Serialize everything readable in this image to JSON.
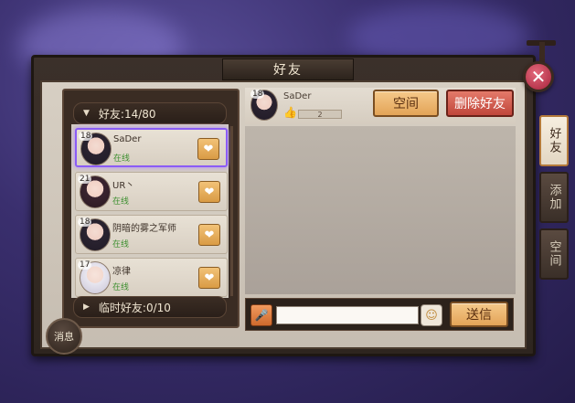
{
  "window": {
    "title": "好友",
    "close_label": "✕"
  },
  "friend_group": {
    "label": "好友:14/80"
  },
  "temp_group": {
    "label": "临时好友:0/10"
  },
  "friends": [
    {
      "level": "18",
      "name": "SaDer",
      "status": "在线",
      "selected": true
    },
    {
      "level": "21",
      "name": "UR丶",
      "status": "在线",
      "selected": false
    },
    {
      "level": "18",
      "name": "阴暗的雾之军师",
      "status": "在线",
      "selected": false
    },
    {
      "level": "17",
      "name": "凉律",
      "status": "在线",
      "selected": false
    }
  ],
  "selected_friend": {
    "level": "18",
    "name": "SaDer",
    "likes": "2"
  },
  "buttons": {
    "space": "空间",
    "delete_friend": "删除好友",
    "send": "送信",
    "messages": "消息"
  },
  "chat_input": {
    "value": "",
    "placeholder": ""
  },
  "side_tabs": [
    {
      "label": "好友",
      "active": true
    },
    {
      "label": "添加",
      "active": false
    },
    {
      "label": "空间",
      "active": false
    }
  ],
  "icons": {
    "gift": "heart-gift-icon",
    "mic": "microphone-icon",
    "emoji": "emoji-icon",
    "like": "thumbs-up-icon",
    "close": "close-icon"
  }
}
